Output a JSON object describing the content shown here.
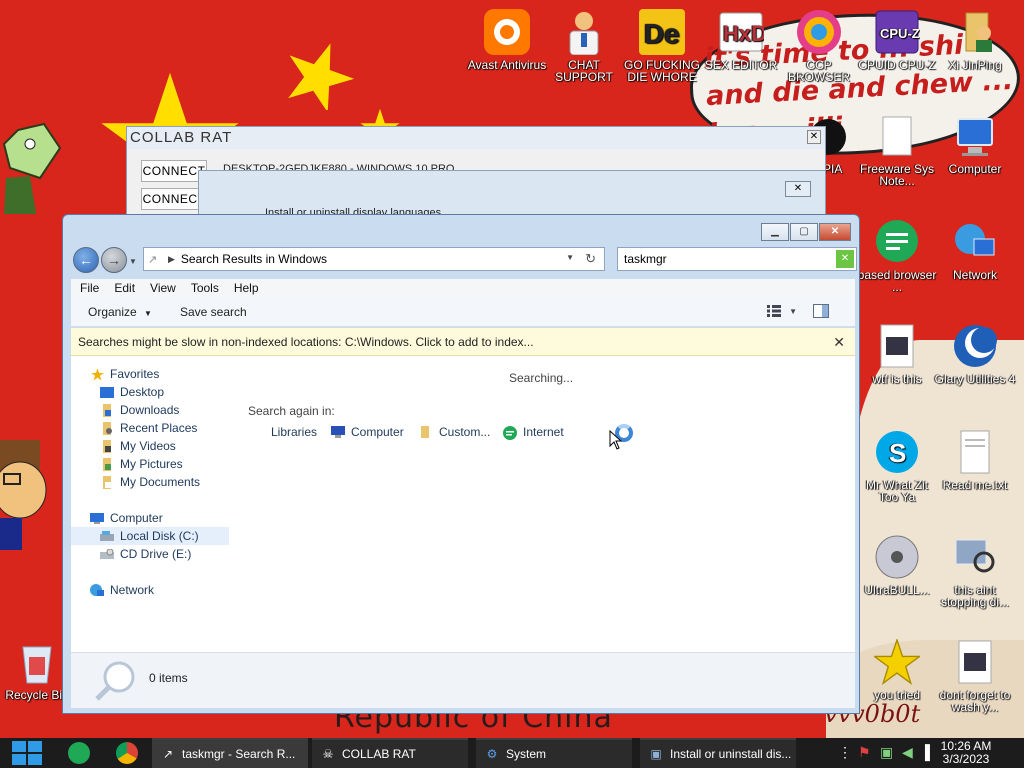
{
  "desktop_icons": {
    "avast": "Avast Antivirus",
    "chat_support": "CHAT SUPPORT",
    "go_die": "GO FUCKING DIE WHORE",
    "hex_editor": "SEX EDITOR",
    "ccp_browser": "CCP BROWSER",
    "cpuid": "CPUID CPU-Z",
    "xkunping": "Xi JinPing",
    "topia": "OPIA",
    "freeware": "Freeware Sys Note...",
    "computer": "Computer",
    "based_browser": "based browser ...",
    "network": "Network",
    "wtf": "wtf is this",
    "glary": "Glary Utilities 4",
    "skype": "Mr What Zit Too Ya",
    "readme": "Read me.txt",
    "ultrabull": "UltraBULL...",
    "this_aint": "this aint stopping di...",
    "you_tried": "you tried",
    "dont_forget": "dont forget to wash y...",
    "recycle": "Recycle Bin"
  },
  "wallpaper": {
    "speech_text": "it's time to ... shi and die and chew ... ing ... illi",
    "banner_text": "Republic of China",
    "signature": "vvv0b0t"
  },
  "rat_window": {
    "title": "COLLAB RAT",
    "connect_label": "CONNECT",
    "row_text": "DESKTOP-2GFDJKE880 - WINDOWS 10 PRO"
  },
  "lang_window": {
    "text": "Install or uninstall display languages"
  },
  "explorer": {
    "address": "Search Results in Windows",
    "search_value": "taskmgr",
    "menu": [
      "File",
      "Edit",
      "View",
      "Tools",
      "Help"
    ],
    "cmd_organize": "Organize",
    "cmd_save_search": "Save search",
    "infobar": "Searches might be slow in non-indexed locations: C:\\Windows. Click to add to index...",
    "nav": {
      "favorites": "Favorites",
      "desktop": "Desktop",
      "downloads": "Downloads",
      "recent": "Recent Places",
      "videos": "My Videos",
      "pictures": "My Pictures",
      "documents": "My Documents",
      "computer": "Computer",
      "local_disk": "Local Disk (C:)",
      "cd_drive": "CD Drive (E:)",
      "network": "Network"
    },
    "searching": "Searching...",
    "search_again": "Search again in:",
    "locations": [
      "Libraries",
      "Computer",
      "Custom...",
      "Internet"
    ],
    "items_count": "0 items"
  },
  "taskbar": {
    "tasks": [
      "taskmgr - Search R...",
      "COLLAB RAT",
      "System",
      "Install or uninstall dis..."
    ],
    "time": "10:26 AM",
    "date": "3/3/2023"
  },
  "colors": {
    "wallpaper_red": "#d8261c",
    "star_yellow": "#ffde00",
    "explorer_frame": "#c9dcf0",
    "taskbar": "#1c1c1c"
  }
}
